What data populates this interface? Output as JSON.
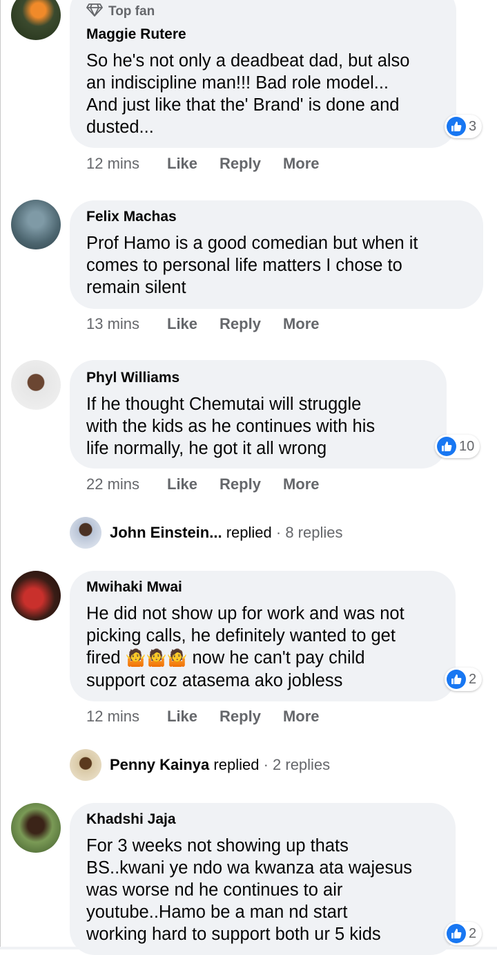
{
  "comments": [
    {
      "badge": "Top fan",
      "author": "Maggie Rutere",
      "text": "So he's not only a deadbeat dad, but also\nan indiscipline man!!! Bad role model...\nAnd just like that the' Brand' is done and\ndusted...",
      "reactions": "3",
      "time": "12 mins"
    },
    {
      "author": "Felix Machas",
      "text": "Prof Hamo is a good comedian but when it\ncomes to personal life matters I chose to\nremain silent",
      "time": "13 mins"
    },
    {
      "author": "Phyl Williams",
      "text": "If he thought Chemutai will struggle\nwith the kids as he continues with his\nlife normally, he got it all wrong",
      "reactions": "10",
      "time": "22 mins"
    },
    {
      "author": "Mwihaki Mwai",
      "text_line1": "He did not show up for work and was not",
      "text_line2": "picking calls, he definitely wanted to get",
      "text_line3_pre": "fired",
      "text_line3_post": " now he can't pay child",
      "text_line4": "support coz atasema ako jobless",
      "reactions": "2",
      "time": "12 mins"
    },
    {
      "author": "Khadshi Jaja",
      "text": "For 3 weeks not showing up thats\nBS..kwani ye ndo wa kwanza ata wajesus\nwas worse nd he continues to air\nyoutube..Hamo be a man nd start\nworking hard to support both ur 5 kids",
      "reactions": "2"
    }
  ],
  "actions": {
    "like": "Like",
    "reply": "Reply",
    "more": "More"
  },
  "replies": [
    {
      "name": "John Einstein...",
      "verb": "replied",
      "count": "· 8 replies"
    },
    {
      "name": "Penny Kainya",
      "verb": "replied",
      "count": "· 2 replies"
    }
  ],
  "emoji": "🤷",
  "icons": {
    "badge": "diamond-icon",
    "reaction": "thumbs-up-icon"
  },
  "colors": {
    "bubble": "#f0f2f5",
    "meta": "#65676b",
    "like": "#1877f2"
  }
}
